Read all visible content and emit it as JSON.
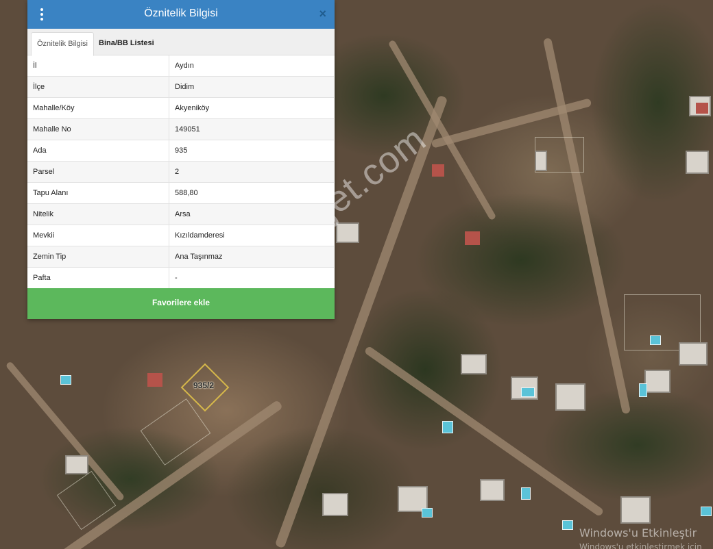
{
  "panel": {
    "title": "Öznitelik Bilgisi",
    "close_symbol": "×",
    "tabs": [
      {
        "label": "Öznitelik Bilgisi",
        "active": true
      },
      {
        "label": "Bina/BB Listesi",
        "active": false
      }
    ],
    "rows": [
      {
        "key": "İl",
        "value": "Aydın"
      },
      {
        "key": "İlçe",
        "value": "Didim"
      },
      {
        "key": "Mahalle/Köy",
        "value": "Akyeniköy"
      },
      {
        "key": "Mahalle No",
        "value": "149051"
      },
      {
        "key": "Ada",
        "value": "935"
      },
      {
        "key": "Parsel",
        "value": "2"
      },
      {
        "key": "Tapu Alanı",
        "value": "588,80"
      },
      {
        "key": "Nitelik",
        "value": "Arsa"
      },
      {
        "key": "Mevkii",
        "value": "Kızıldamderesi"
      },
      {
        "key": "Zemin Tip",
        "value": "Ana Taşınmaz"
      },
      {
        "key": "Pafta",
        "value": "-"
      }
    ],
    "favorite_button": "Favorilere ekle"
  },
  "map": {
    "parcel_label": "935/2",
    "watermark": "emlakjet.com"
  },
  "os_overlay": {
    "activate_windows": "Windows'u Etkinleştir",
    "activate_windows_sub": "Windows'u etkinleştirmek için"
  },
  "colors": {
    "header": "#3a83c3",
    "favorite_button": "#5cb85c",
    "parcel_outline": "#d6b84a"
  },
  "icons": {
    "menu": "vertical-ellipsis-icon",
    "close": "close-icon"
  }
}
